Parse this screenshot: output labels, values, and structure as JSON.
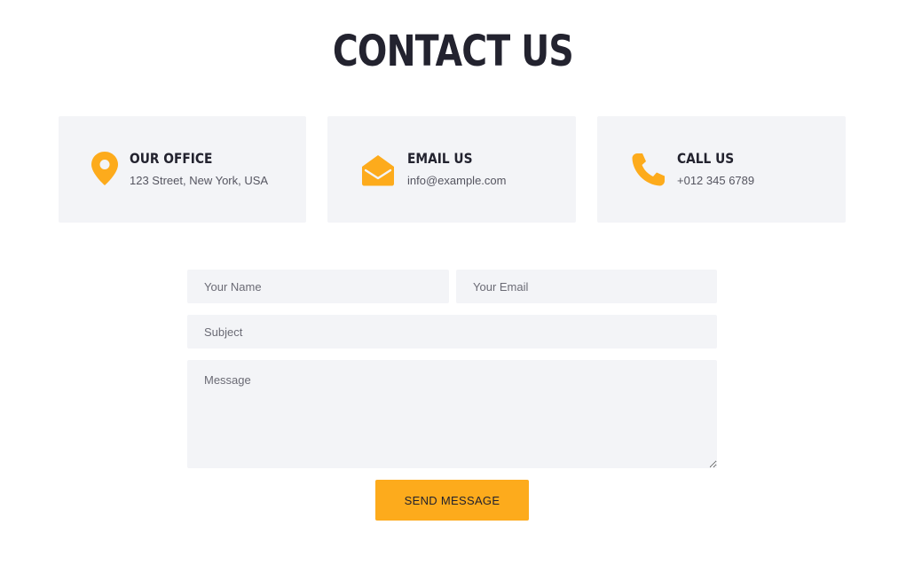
{
  "page": {
    "title": "CONTACT US"
  },
  "colors": {
    "accent": "#fdab1c",
    "card_bg": "#f3f4f7",
    "heading": "#23232f"
  },
  "cards": [
    {
      "icon": "map-pin-icon",
      "title": "OUR OFFICE",
      "text": "123 Street, New York, USA"
    },
    {
      "icon": "envelope-icon",
      "title": "EMAIL US",
      "text": "info@example.com"
    },
    {
      "icon": "phone-icon",
      "title": "CALL US",
      "text": "+012 345 6789"
    }
  ],
  "form": {
    "name_placeholder": "Your Name",
    "email_placeholder": "Your Email",
    "subject_placeholder": "Subject",
    "message_placeholder": "Message",
    "submit_label": "SEND MESSAGE"
  }
}
